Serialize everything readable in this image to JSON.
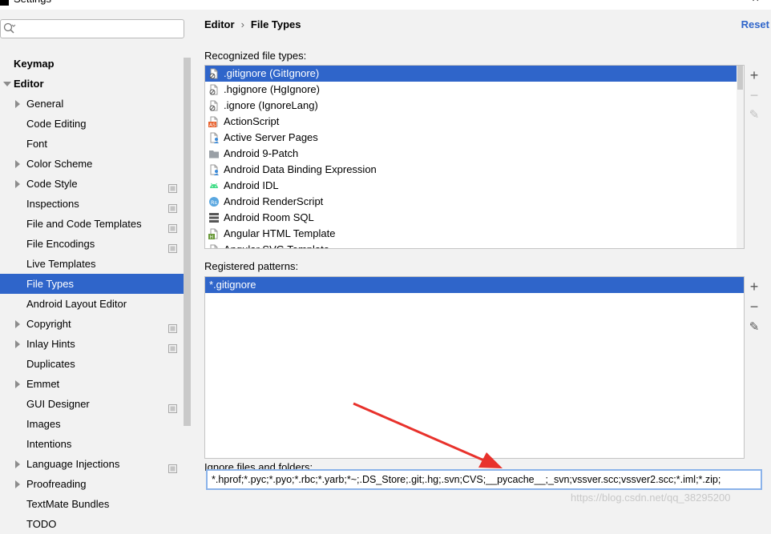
{
  "window": {
    "title": "Settings",
    "close_glyph": "×"
  },
  "sidebar": {
    "search": {
      "placeholder": "",
      "value": ""
    },
    "items": [
      {
        "label": "Keymap",
        "level": 0,
        "bold": true,
        "arrow": "none",
        "project": false,
        "selected": false
      },
      {
        "label": "Editor",
        "level": 0,
        "bold": true,
        "arrow": "down",
        "project": false,
        "selected": false
      },
      {
        "label": "General",
        "level": 1,
        "bold": false,
        "arrow": "right",
        "project": false,
        "selected": false
      },
      {
        "label": "Code Editing",
        "level": 1,
        "bold": false,
        "arrow": "none",
        "project": false,
        "selected": false
      },
      {
        "label": "Font",
        "level": 1,
        "bold": false,
        "arrow": "none",
        "project": false,
        "selected": false
      },
      {
        "label": "Color Scheme",
        "level": 1,
        "bold": false,
        "arrow": "right",
        "project": false,
        "selected": false
      },
      {
        "label": "Code Style",
        "level": 1,
        "bold": false,
        "arrow": "right",
        "project": true,
        "selected": false
      },
      {
        "label": "Inspections",
        "level": 1,
        "bold": false,
        "arrow": "none",
        "project": true,
        "selected": false
      },
      {
        "label": "File and Code Templates",
        "level": 1,
        "bold": false,
        "arrow": "none",
        "project": true,
        "selected": false
      },
      {
        "label": "File Encodings",
        "level": 1,
        "bold": false,
        "arrow": "none",
        "project": true,
        "selected": false
      },
      {
        "label": "Live Templates",
        "level": 1,
        "bold": false,
        "arrow": "none",
        "project": false,
        "selected": false
      },
      {
        "label": "File Types",
        "level": 1,
        "bold": false,
        "arrow": "none",
        "project": false,
        "selected": true
      },
      {
        "label": "Android Layout Editor",
        "level": 1,
        "bold": false,
        "arrow": "none",
        "project": false,
        "selected": false
      },
      {
        "label": "Copyright",
        "level": 1,
        "bold": false,
        "arrow": "right",
        "project": true,
        "selected": false
      },
      {
        "label": "Inlay Hints",
        "level": 1,
        "bold": false,
        "arrow": "right",
        "project": true,
        "selected": false
      },
      {
        "label": "Duplicates",
        "level": 1,
        "bold": false,
        "arrow": "none",
        "project": false,
        "selected": false
      },
      {
        "label": "Emmet",
        "level": 1,
        "bold": false,
        "arrow": "right",
        "project": false,
        "selected": false
      },
      {
        "label": "GUI Designer",
        "level": 1,
        "bold": false,
        "arrow": "none",
        "project": true,
        "selected": false
      },
      {
        "label": "Images",
        "level": 1,
        "bold": false,
        "arrow": "none",
        "project": false,
        "selected": false
      },
      {
        "label": "Intentions",
        "level": 1,
        "bold": false,
        "arrow": "none",
        "project": false,
        "selected": false
      },
      {
        "label": "Language Injections",
        "level": 1,
        "bold": false,
        "arrow": "right",
        "project": true,
        "selected": false
      },
      {
        "label": "Proofreading",
        "level": 1,
        "bold": false,
        "arrow": "right",
        "project": false,
        "selected": false
      },
      {
        "label": "TextMate Bundles",
        "level": 1,
        "bold": false,
        "arrow": "none",
        "project": false,
        "selected": false
      },
      {
        "label": "TODO",
        "level": 1,
        "bold": false,
        "arrow": "none",
        "project": false,
        "selected": false
      }
    ]
  },
  "header": {
    "breadcrumb_parent": "Editor",
    "breadcrumb_separator": "›",
    "breadcrumb_current": "File Types",
    "reset_label": "Reset"
  },
  "recognized": {
    "label": "Recognized file types:",
    "items": [
      {
        "label": ".gitignore (GitIgnore)",
        "icon": "ignore-file-icon",
        "selected": true
      },
      {
        "label": ".hgignore (HgIgnore)",
        "icon": "ignore-file-icon",
        "selected": false
      },
      {
        "label": ".ignore (IgnoreLang)",
        "icon": "ignore-file-icon",
        "selected": false
      },
      {
        "label": "ActionScript",
        "icon": "actionscript-file-icon",
        "selected": false
      },
      {
        "label": "Active Server Pages",
        "icon": "asp-file-icon",
        "selected": false
      },
      {
        "label": "Android 9-Patch",
        "icon": "folder-icon",
        "selected": false
      },
      {
        "label": "Android Data Binding Expression",
        "icon": "databinding-file-icon",
        "selected": false
      },
      {
        "label": "Android IDL",
        "icon": "android-icon",
        "selected": false
      },
      {
        "label": "Android RenderScript",
        "icon": "renderscript-icon",
        "selected": false
      },
      {
        "label": "Android Room SQL",
        "icon": "sql-icon",
        "selected": false
      },
      {
        "label": "Angular HTML Template",
        "icon": "angular-html-icon",
        "selected": false
      },
      {
        "label": "Angular SVG Template",
        "icon": "angular-svg-icon",
        "selected": false
      }
    ]
  },
  "patterns": {
    "label": "Registered patterns:",
    "items": [
      {
        "label": "*.gitignore",
        "selected": true
      }
    ]
  },
  "toolbar": {
    "add_glyph": "+",
    "remove_glyph": "−",
    "edit_glyph": "✎"
  },
  "ignore": {
    "label": "Ignore files and folders:",
    "value": "*.hprof;*.pyc;*.pyo;*.rbc;*.yarb;*~;.DS_Store;.git;.hg;.svn;CVS;__pycache__;_svn;vssver.scc;vssver2.scc;*.iml;*.zip;"
  },
  "annotation": {
    "arrow_color": "#e8322c"
  },
  "colors": {
    "selection": "#2f65ca",
    "link": "#2f65ca"
  },
  "watermark": "https://blog.csdn.net/qq_38295200"
}
